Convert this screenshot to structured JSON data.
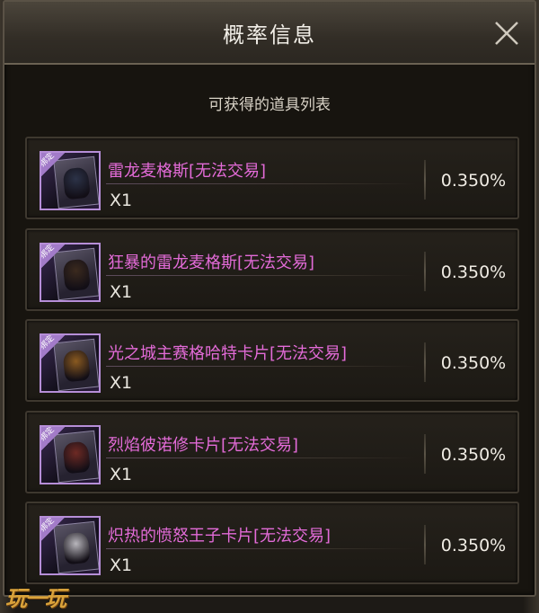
{
  "dialog": {
    "title": "概率信息",
    "close_icon": "close-icon",
    "subtitle": "可获得的道具列表"
  },
  "items": [
    {
      "name": "雷龙麦格斯[无法交易]",
      "qty": "X1",
      "prob": "0.350%",
      "bind_label": "绑定",
      "figure_color": "#2c3348"
    },
    {
      "name": "狂暴的雷龙麦格斯[无法交易]",
      "qty": "X1",
      "prob": "0.350%",
      "bind_label": "绑定",
      "figure_color": "#3b2a1e"
    },
    {
      "name": "光之城主赛格哈特卡片[无法交易]",
      "qty": "X1",
      "prob": "0.350%",
      "bind_label": "绑定",
      "figure_color": "#8a5a20"
    },
    {
      "name": "烈焰彼诺修卡片[无法交易]",
      "qty": "X1",
      "prob": "0.350%",
      "bind_label": "绑定",
      "figure_color": "#6e2a24"
    },
    {
      "name": "炽热的愤怒王子卡片[无法交易]",
      "qty": "X1",
      "prob": "0.350%",
      "bind_label": "绑定",
      "figure_color": "#b8b6bc"
    }
  ],
  "watermark": "玩一玩",
  "colors": {
    "item_name": "#e36bd8",
    "icon_border": "#b68ed8",
    "watermark": "#d9a23a"
  }
}
